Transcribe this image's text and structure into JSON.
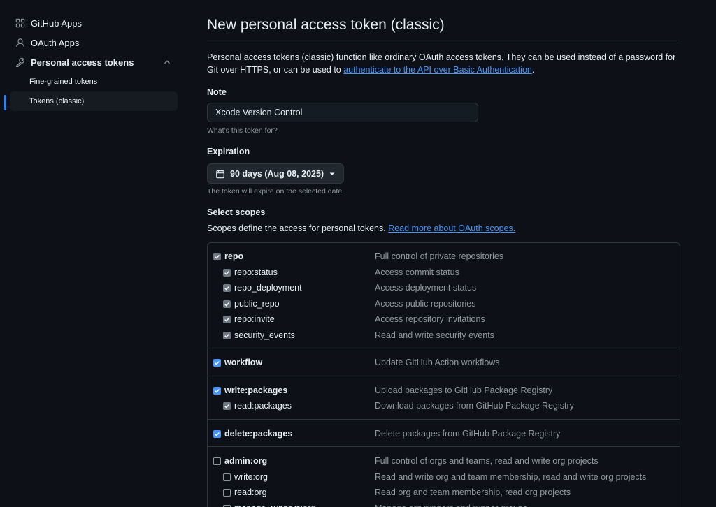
{
  "sidebar": {
    "items": [
      {
        "label": "GitHub Apps",
        "icon": "apps-icon"
      },
      {
        "label": "OAuth Apps",
        "icon": "person-icon"
      },
      {
        "label": "Personal access tokens",
        "icon": "key-icon"
      }
    ],
    "sub_items": [
      {
        "label": "Fine-grained tokens",
        "active": false
      },
      {
        "label": "Tokens (classic)",
        "active": true
      }
    ]
  },
  "page": {
    "title": "New personal access token (classic)",
    "intro_text": "Personal access tokens (classic) function like ordinary OAuth access tokens. They can be used instead of a password for Git over HTTPS, or can be used to ",
    "intro_link": "authenticate to the API over Basic Authentication",
    "intro_end": "."
  },
  "note": {
    "label": "Note",
    "value": "Xcode Version Control",
    "hint": "What’s this token for?"
  },
  "expiration": {
    "label": "Expiration",
    "value": "90 days (Aug 08, 2025)",
    "hint": "The token will expire on the selected date"
  },
  "scopes": {
    "label": "Select scopes",
    "description": "Scopes define the access for personal tokens. ",
    "link": "Read more about OAuth scopes.",
    "groups": [
      {
        "name": "repo",
        "desc": "Full control of private repositories",
        "state": "checked-dim",
        "children": [
          {
            "name": "repo:status",
            "desc": "Access commit status",
            "state": "checked-dim"
          },
          {
            "name": "repo_deployment",
            "desc": "Access deployment status",
            "state": "checked-dim"
          },
          {
            "name": "public_repo",
            "desc": "Access public repositories",
            "state": "checked-dim"
          },
          {
            "name": "repo:invite",
            "desc": "Access repository invitations",
            "state": "checked-dim"
          },
          {
            "name": "security_events",
            "desc": "Read and write security events",
            "state": "checked-dim"
          }
        ]
      },
      {
        "name": "workflow",
        "desc": "Update GitHub Action workflows",
        "state": "checked-blue",
        "children": []
      },
      {
        "name": "write:packages",
        "desc": "Upload packages to GitHub Package Registry",
        "state": "checked-blue",
        "children": [
          {
            "name": "read:packages",
            "desc": "Download packages from GitHub Package Registry",
            "state": "checked-dim"
          }
        ]
      },
      {
        "name": "delete:packages",
        "desc": "Delete packages from GitHub Package Registry",
        "state": "checked-blue",
        "children": []
      },
      {
        "name": "admin:org",
        "desc": "Full control of orgs and teams, read and write org projects",
        "state": "unchecked",
        "children": [
          {
            "name": "write:org",
            "desc": "Read and write org and team membership, read and write org projects",
            "state": "unchecked"
          },
          {
            "name": "read:org",
            "desc": "Read org and team membership, read org projects",
            "state": "unchecked"
          },
          {
            "name": "manage_runners:org",
            "desc": "Manage org runners and runner groups",
            "state": "unchecked"
          }
        ]
      }
    ]
  }
}
